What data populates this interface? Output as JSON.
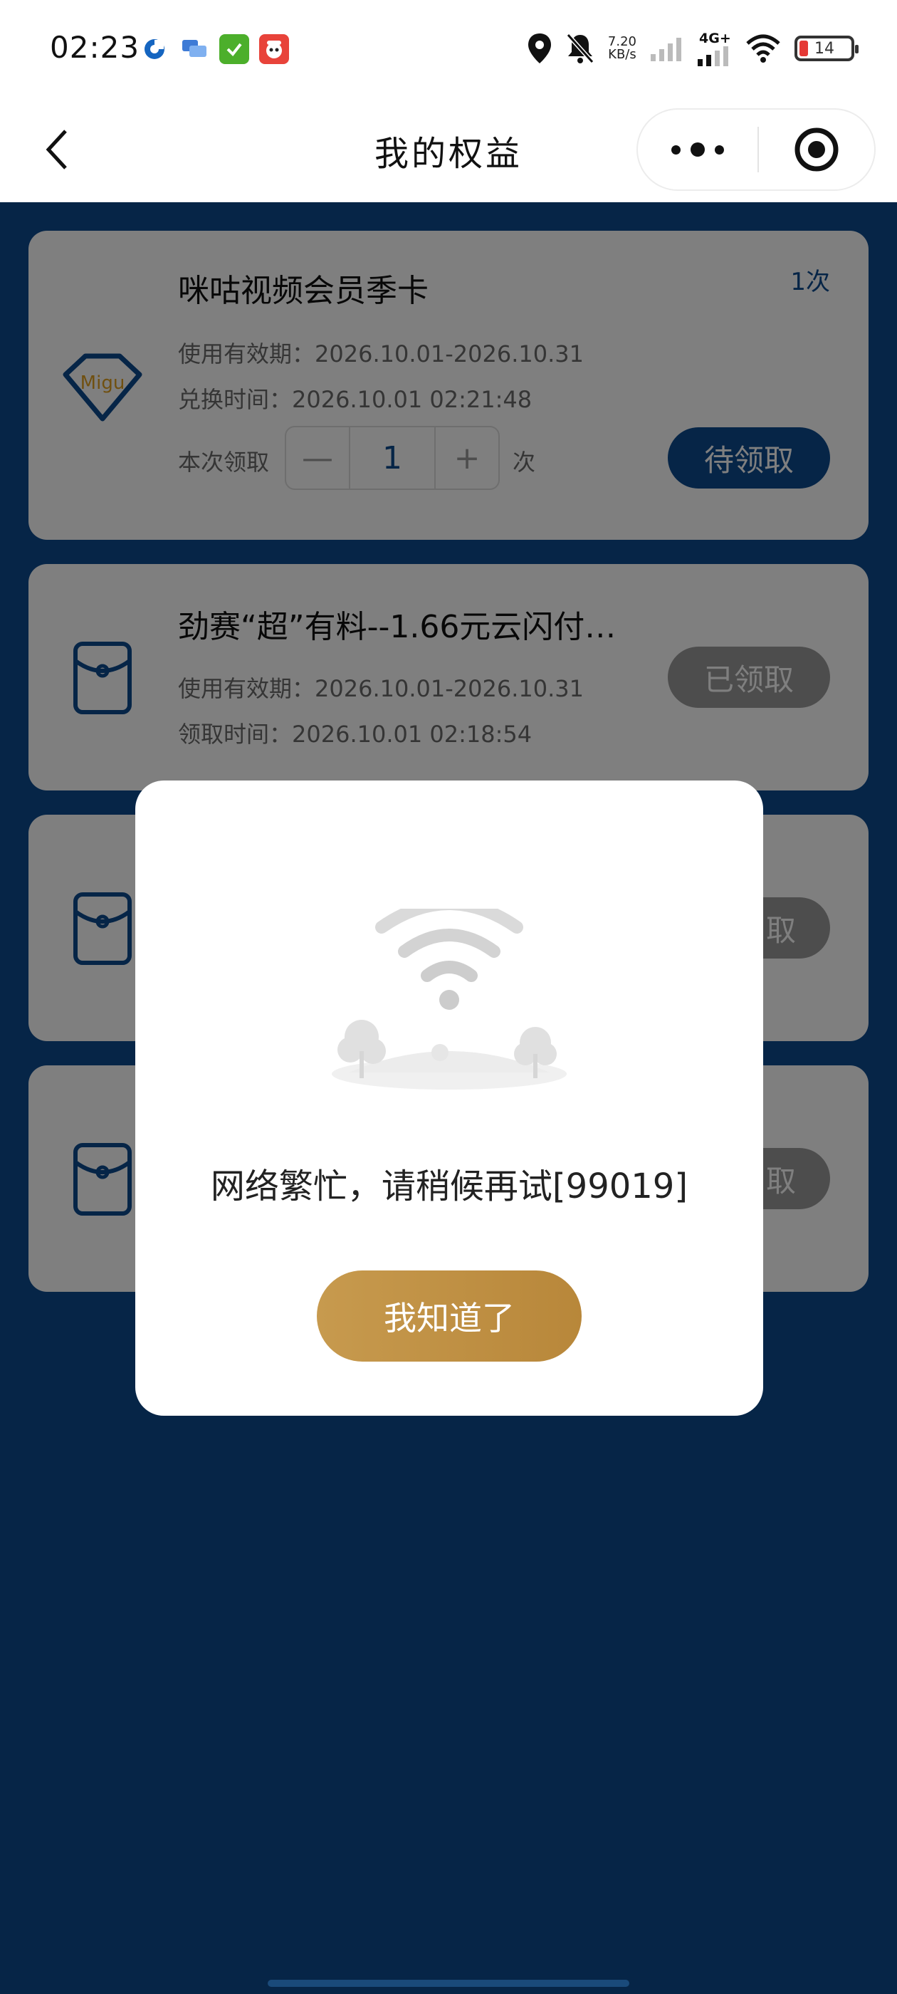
{
  "status_bar": {
    "time": "02:23",
    "net_speed_value": "7.20",
    "net_speed_unit": "KB/s",
    "network_label": "4G+",
    "battery_level": "14",
    "icons": [
      "location-icon",
      "mute-bell-icon",
      "signal-icon",
      "signal-4g-icon",
      "wifi-icon",
      "battery-icon"
    ],
    "notification_icons": [
      "bank-app-icon",
      "chat-app-icon",
      "checklist-app-icon",
      "mascot-app-icon"
    ]
  },
  "nav": {
    "title": "我的权益",
    "back_icon": "chevron-left-icon",
    "more_icon": "more-dots-icon",
    "close_icon": "target-close-icon"
  },
  "cards": [
    {
      "title": "咪咕视频会员季卡",
      "times": "1次",
      "icon": "migu-logo-icon",
      "icon_text": "Migu",
      "validity": "使用有效期：2026.10.01-2026.10.31",
      "time_line": "兑换时间：2026.10.01 02:21:48",
      "qty_label": "本次领取",
      "qty_minus": "—",
      "qty_value": "1",
      "qty_plus": "+",
      "qty_unit": "次",
      "button": "待领取"
    },
    {
      "title": "劲赛“超”有料--1.66元云闪付…",
      "icon": "red-envelope-icon",
      "validity": "使用有效期：2026.10.01-2026.10.31",
      "time_line": "领取时间：2026.10.01 02:18:54",
      "button": "已领取"
    },
    {
      "icon": "red-envelope-icon",
      "button_visible": "取"
    },
    {
      "icon": "red-envelope-icon",
      "button_visible": "取"
    }
  ],
  "dialog": {
    "illustration": "network-error-wifi-illustration",
    "message": "网络繁忙，请稍候再试[99019]",
    "button": "我知道了"
  },
  "colors": {
    "primary": "#0c4a8f",
    "gold_button": "#c0914a",
    "disabled_button": "#9a9a9a",
    "overlay": "rgba(0,0,0,0.5)"
  }
}
